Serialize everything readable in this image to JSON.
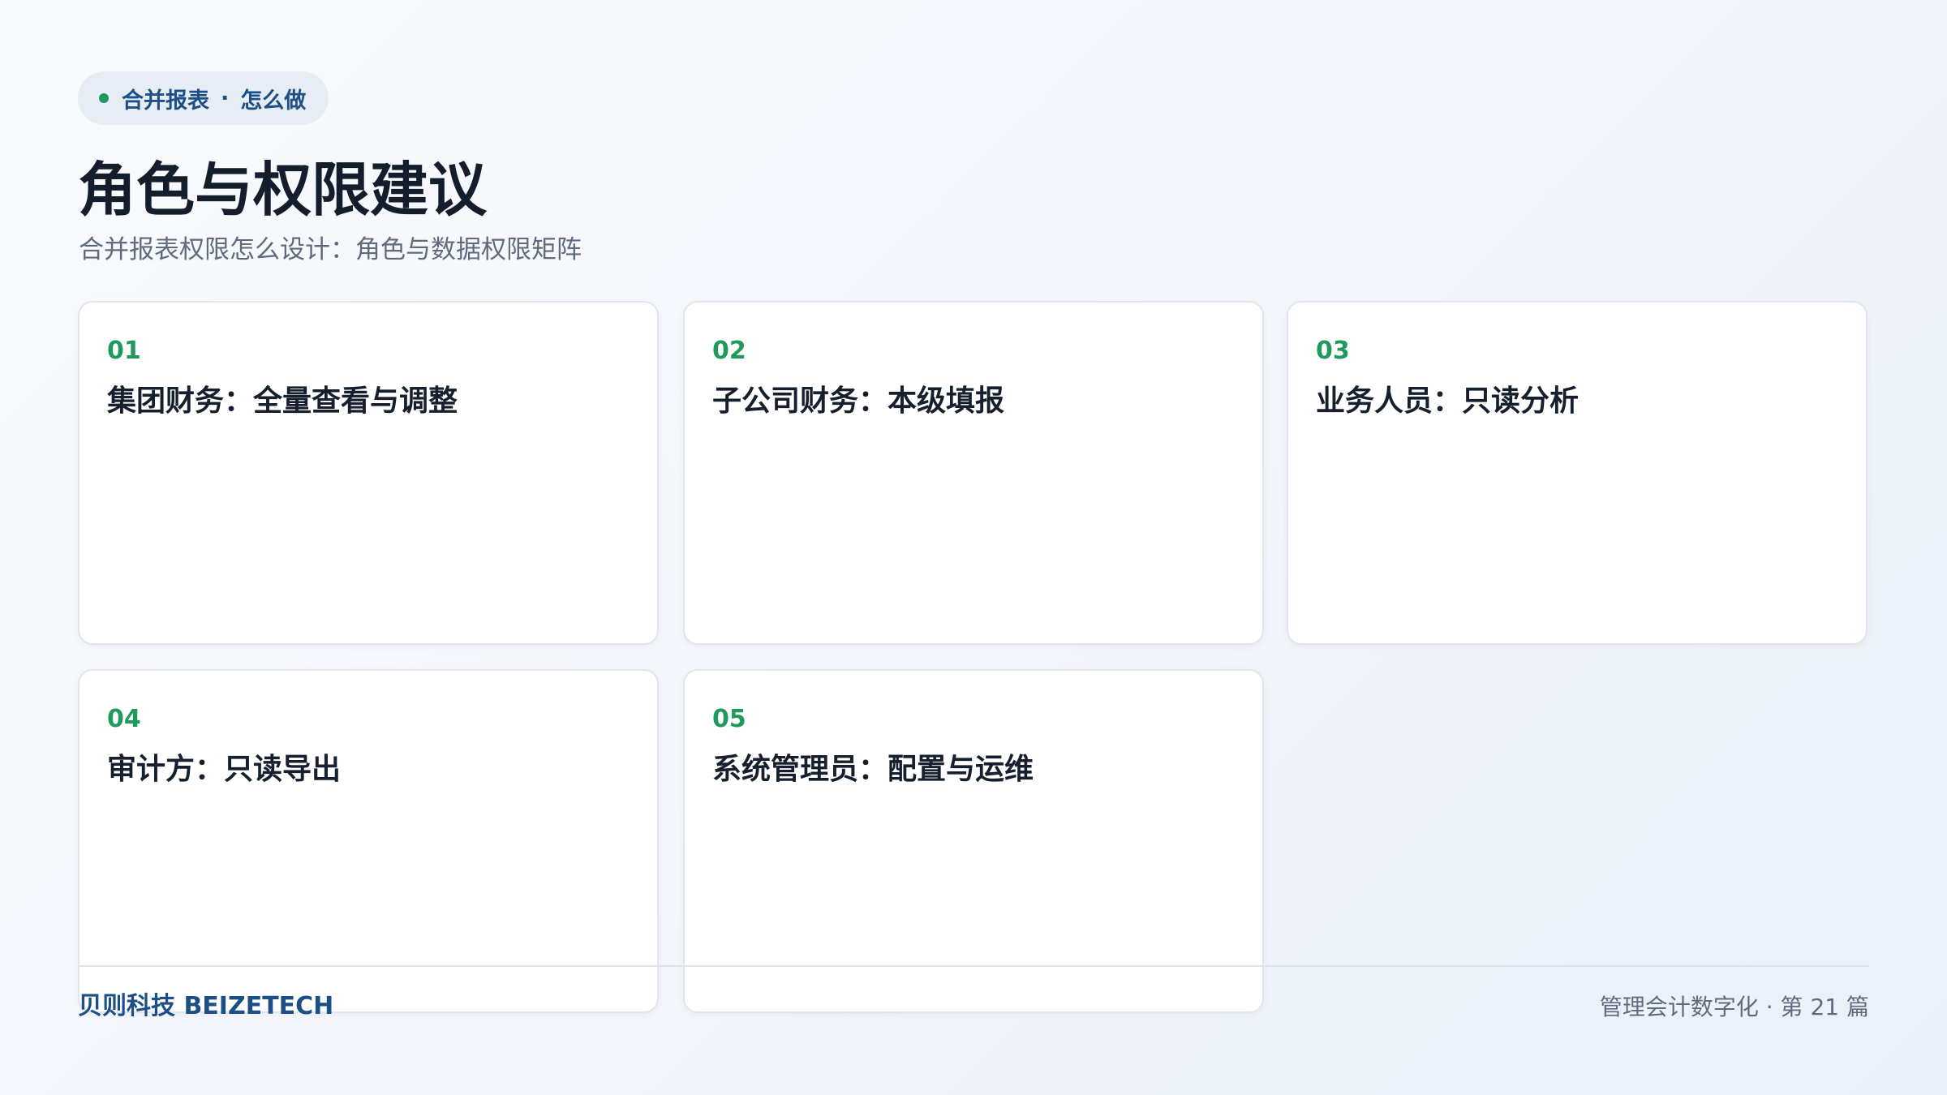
{
  "tag": {
    "section": "合并报表",
    "separator": "·",
    "subsection": "怎么做"
  },
  "title": "角色与权限建议",
  "subtitle": "合并报表权限怎么设计：角色与数据权限矩阵",
  "cards": [
    {
      "number": "01",
      "title": "集团财务：全量查看与调整"
    },
    {
      "number": "02",
      "title": "子公司财务：本级填报"
    },
    {
      "number": "03",
      "title": "业务人员：只读分析"
    },
    {
      "number": "04",
      "title": "审计方：只读导出"
    },
    {
      "number": "05",
      "title": "系统管理员：配置与运维"
    }
  ],
  "footer": {
    "brand": "贝则科技 BEIZETECH",
    "series": "管理会计数字化 · 第 21 篇"
  },
  "colors": {
    "accent_green": "#1f9a5c",
    "brand_blue": "#1c4f86",
    "title_dark": "#141d2b"
  }
}
